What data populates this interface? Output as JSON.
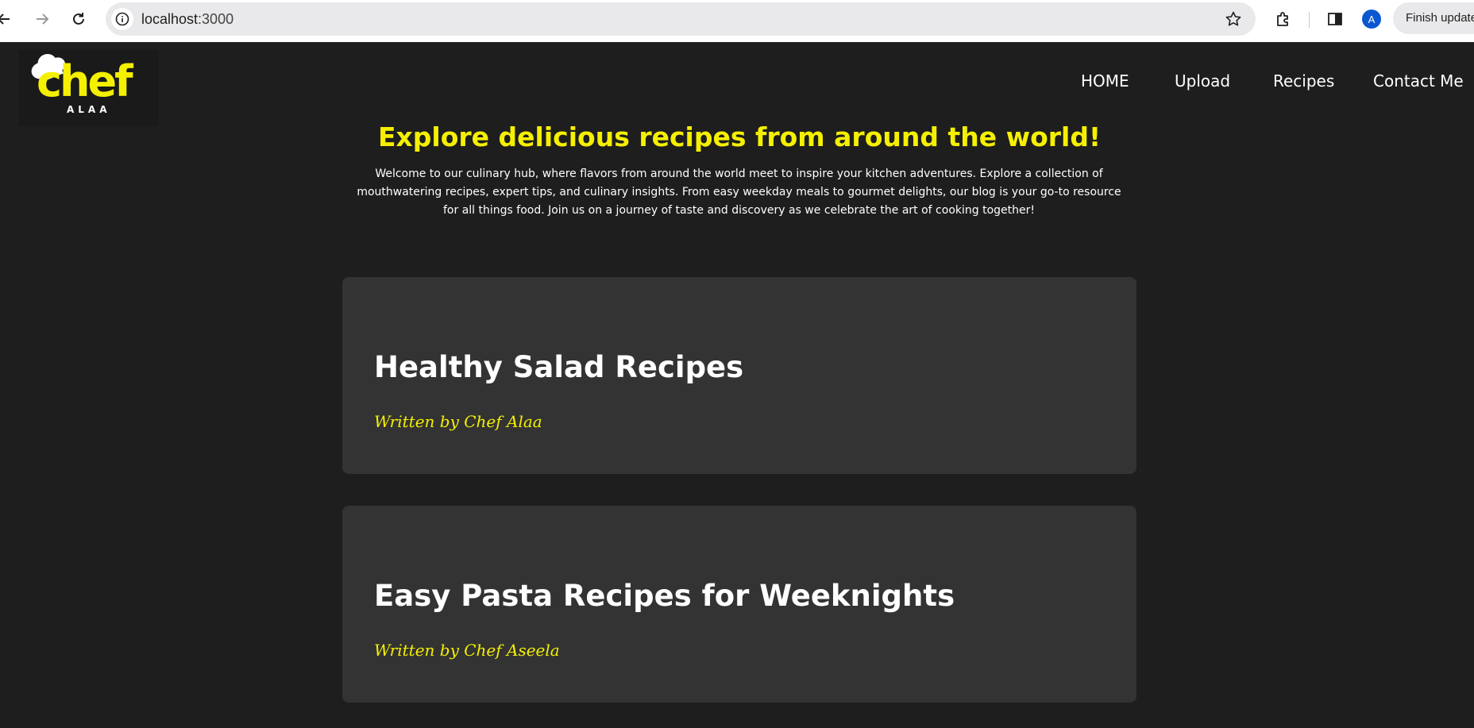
{
  "browser": {
    "url_host": "localhost",
    "url_port": ":3000",
    "update_label": "Finish update",
    "avatar_letter": "A"
  },
  "nav": {
    "items": [
      {
        "label": "HOME"
      },
      {
        "label": "Upload"
      },
      {
        "label": "Recipes"
      },
      {
        "label": "Contact Me"
      }
    ]
  },
  "logo": {
    "main": "chef",
    "sub": "ALAA"
  },
  "hero": {
    "title": "Explore delicious recipes from around the world!",
    "text": "Welcome to our culinary hub, where flavors from around the world meet to inspire your kitchen adventures. Explore a collection of mouthwatering recipes, expert tips, and culinary insights. From easy weekday meals to gourmet delights, our blog is your go-to resource for all things food. Join us on a journey of taste and discovery as we celebrate the art of cooking together!"
  },
  "posts": [
    {
      "title": "Healthy Salad Recipes",
      "author": "Written by Chef Alaa"
    },
    {
      "title": "Easy Pasta Recipes for Weeknights",
      "author": "Written by Chef Aseela"
    }
  ],
  "colors": {
    "accent": "#f5f000",
    "background": "#1e1e1e",
    "card": "#333333"
  }
}
